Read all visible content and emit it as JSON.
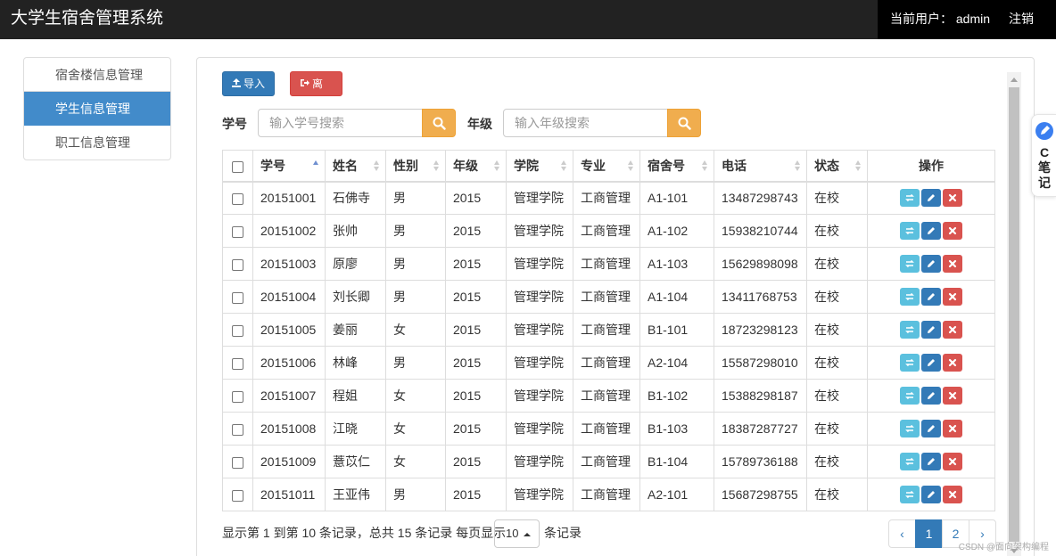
{
  "navbar": {
    "brand": "大学生宿舍管理系统",
    "current_user": "当前用户：  admin",
    "logout": "注销"
  },
  "sidebar": {
    "items": [
      {
        "label": "宿舍楼信息管理"
      },
      {
        "label": "学生信息管理"
      },
      {
        "label": "职工信息管理"
      }
    ],
    "active_index": 1
  },
  "toolbar": {
    "import_label": "导入",
    "leave_label": "离校"
  },
  "search": {
    "student_id_label": "学号",
    "student_id_placeholder": "输入学号搜索",
    "grade_label": "年级",
    "grade_placeholder": "输入年级搜索"
  },
  "table": {
    "columns": [
      "学号",
      "姓名",
      "性别",
      "年级",
      "学院",
      "专业",
      "宿舍号",
      "电话",
      "状态",
      "操作"
    ],
    "rows": [
      [
        "20151001",
        "石佛寺",
        "男",
        "2015",
        "管理学院",
        "工商管理",
        "A1-101",
        "13487298743",
        "在校"
      ],
      [
        "20151002",
        "张帅",
        "男",
        "2015",
        "管理学院",
        "工商管理",
        "A1-102",
        "15938210744",
        "在校"
      ],
      [
        "20151003",
        "原廖",
        "男",
        "2015",
        "管理学院",
        "工商管理",
        "A1-103",
        "15629898098",
        "在校"
      ],
      [
        "20151004",
        "刘长卿",
        "男",
        "2015",
        "管理学院",
        "工商管理",
        "A1-104",
        "13411768753",
        "在校"
      ],
      [
        "20151005",
        "姜丽",
        "女",
        "2015",
        "管理学院",
        "工商管理",
        "B1-101",
        "18723298123",
        "在校"
      ],
      [
        "20151006",
        "林峰",
        "男",
        "2015",
        "管理学院",
        "工商管理",
        "A2-104",
        "15587298010",
        "在校"
      ],
      [
        "20151007",
        "程姐",
        "女",
        "2015",
        "管理学院",
        "工商管理",
        "B1-102",
        "15388298187",
        "在校"
      ],
      [
        "20151008",
        "江晓",
        "女",
        "2015",
        "管理学院",
        "工商管理",
        "B1-103",
        "18387287727",
        "在校"
      ],
      [
        "20151009",
        "薏苡仁",
        "女",
        "2015",
        "管理学院",
        "工商管理",
        "B1-104",
        "15789736188",
        "在校"
      ],
      [
        "20151011",
        "王亚伟",
        "男",
        "2015",
        "管理学院",
        "工商管理",
        "A2-101",
        "15687298755",
        "在校"
      ]
    ]
  },
  "pagination": {
    "info": "显示第 1 到第 10 条记录，总共 15 条记录 每页显示",
    "page_size": "10",
    "suffix": "条记录",
    "prev": "‹",
    "pages": [
      "1",
      "2"
    ],
    "active_page": "1",
    "next": "›"
  },
  "note_widget": {
    "text": "C\n笔\n记"
  },
  "watermark": "CSDN @面向架构编程",
  "colors": {
    "navbar": "#222222",
    "primary": "#337ab7",
    "danger": "#d9534f",
    "warning": "#f0ad4e",
    "info": "#5bc0de",
    "sidebar_active": "#428bca"
  }
}
